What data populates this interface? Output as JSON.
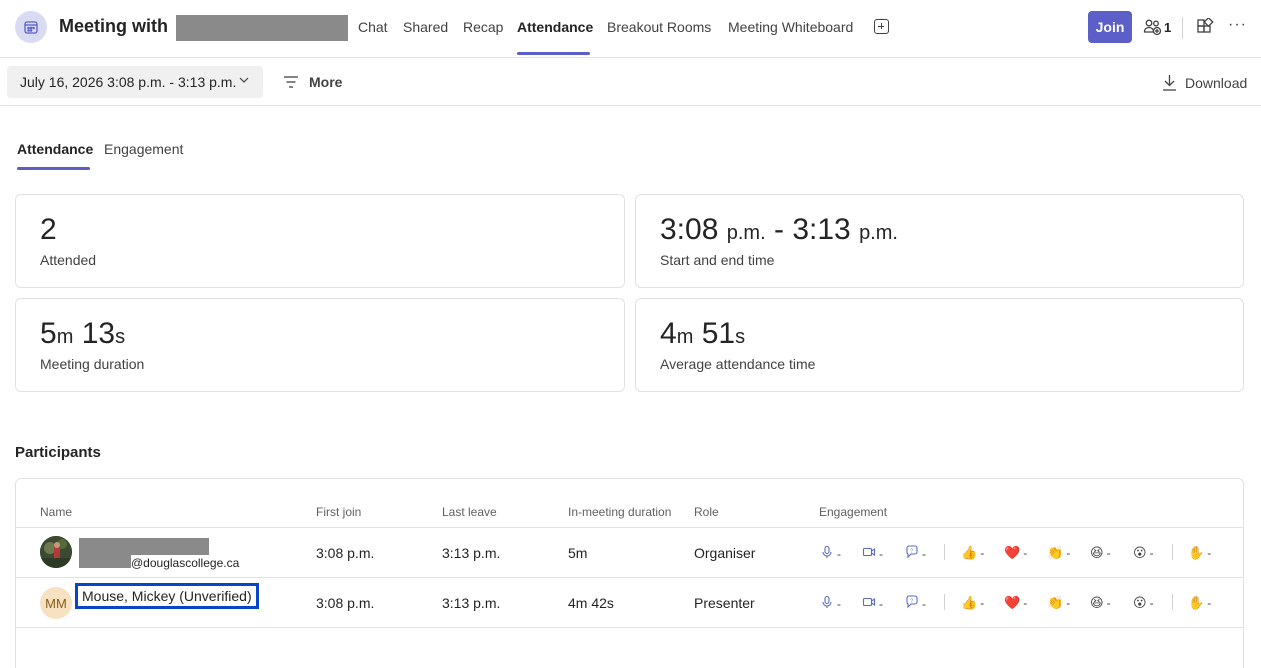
{
  "header": {
    "title": "Meeting with",
    "tabs": [
      {
        "label": "Chat"
      },
      {
        "label": "Shared"
      },
      {
        "label": "Recap"
      },
      {
        "label": "Attendance"
      },
      {
        "label": "Breakout Rooms"
      },
      {
        "label": "Meeting Whiteboard"
      }
    ],
    "active_tab": "Attendance",
    "join_label": "Join",
    "participant_count": "1",
    "more_label": "···"
  },
  "toolbar": {
    "date_range": "July 16, 2026 3:08 p.m. - 3:13 p.m.",
    "more_label": "More",
    "download_label": "Download"
  },
  "inner_tabs": [
    {
      "label": "Attendance"
    },
    {
      "label": "Engagement"
    }
  ],
  "stats": {
    "attended": {
      "value": "2",
      "label": "Attended"
    },
    "start_end": {
      "start_num": "3:08",
      "start_unit": "p.m.",
      "sep": "-",
      "end_num": "3:13",
      "end_unit": "p.m.",
      "label": "Start and end time"
    },
    "duration": {
      "m": "5",
      "m_unit": "m",
      "s": "13",
      "s_unit": "s",
      "label": "Meeting duration"
    },
    "avg_attendance": {
      "m": "4",
      "m_unit": "m",
      "s": "51",
      "s_unit": "s",
      "label": "Average attendance time"
    }
  },
  "participants": {
    "title": "Participants",
    "columns": [
      "Name",
      "First join",
      "Last leave",
      "In-meeting duration",
      "Role",
      "Engagement"
    ],
    "rows": [
      {
        "name_suffix": "@douglascollege.ca",
        "first_join": "3:08 p.m.",
        "last_leave": "3:13 p.m.",
        "duration": "5m",
        "role": "Organiser",
        "engagement": [
          "-",
          "-",
          "-",
          "-",
          "-",
          "-",
          "-",
          "-",
          "-"
        ]
      },
      {
        "initials": "MM",
        "name": "Mouse, Mickey (Unverified)",
        "first_join": "3:08 p.m.",
        "last_leave": "3:13 p.m.",
        "duration": "4m 42s",
        "role": "Presenter",
        "engagement": [
          "-",
          "-",
          "-",
          "-",
          "-",
          "-",
          "-",
          "-",
          "-"
        ]
      }
    ]
  },
  "engagement_icons": [
    "mic-icon",
    "camera-icon",
    "chat-icon",
    "thumbs-up-icon",
    "heart-icon",
    "clap-icon",
    "laugh-icon",
    "surprised-icon",
    "raised-hand-icon"
  ],
  "colors": {
    "accent": "#5b5fc7",
    "highlight": "#0a44c8"
  }
}
